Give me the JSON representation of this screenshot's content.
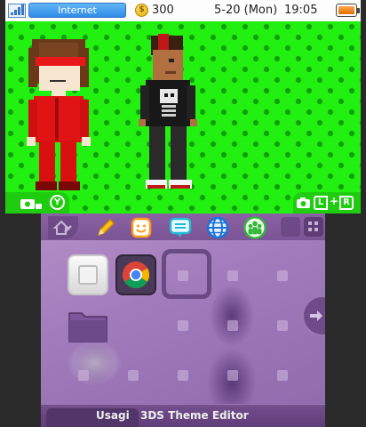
{
  "status_bar": {
    "connection": "Internet",
    "play_coins": "300",
    "date": "5-20 (Mon)",
    "time": "19:05",
    "icons": [
      "signal-icon",
      "coin-icon",
      "battery-icon"
    ]
  },
  "top_screen": {
    "background_color": "#22ee11",
    "pattern_color": "#0f9d08",
    "hints": {
      "left_icons": [
        "camera-icon",
        "y-button-icon"
      ],
      "right_icons": [
        "camera-icon",
        "l-button-icon",
        "r-button-icon"
      ],
      "left_letter": "Y",
      "l_letter": "L",
      "plus": "+",
      "r_letter": "R"
    }
  },
  "bottom_screen": {
    "theme_color": "#a07cbb",
    "toolbar_icons": [
      "home-settings-icon",
      "pencil-icon",
      "miiverse-face-icon",
      "notifications-icon",
      "internet-browser-icon",
      "friends-icon"
    ],
    "apps": [
      "blank-card-slot",
      "browser-app",
      "folder-app"
    ],
    "bottom_bar": {
      "author": "Usagi",
      "title": "3DS Theme Editor"
    }
  }
}
